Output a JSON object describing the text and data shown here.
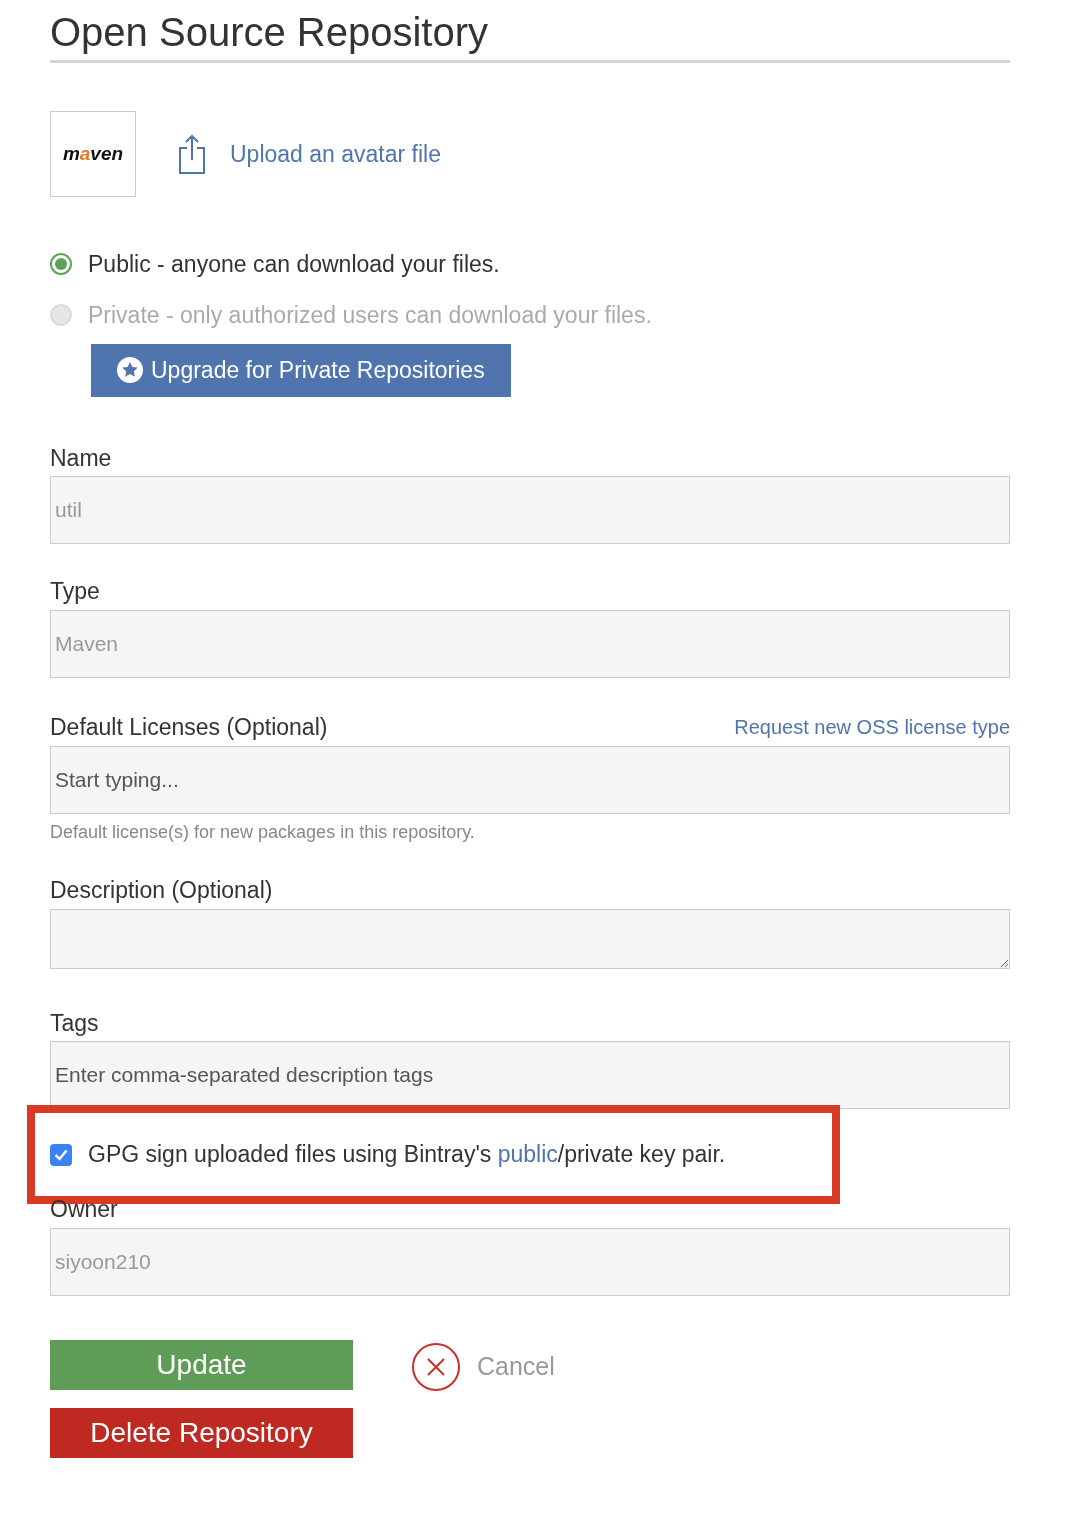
{
  "title": "Open Source Repository",
  "avatar": {
    "logo_text": "maven",
    "upload_link": "Upload an avatar file"
  },
  "visibility": [
    {
      "label": "Public - anyone can download your files.",
      "selected": true,
      "disabled": false
    },
    {
      "label": "Private - only authorized users can download your files.",
      "selected": false,
      "disabled": true
    }
  ],
  "upgrade_button": "Upgrade for Private Repositories",
  "fields": [
    {
      "kind": "input",
      "label": "Name",
      "value": "util",
      "disabled": true
    },
    {
      "kind": "input",
      "label": "Type",
      "value": "Maven",
      "disabled": true
    },
    {
      "kind": "input",
      "label": "Default Licenses (Optional)",
      "link": "Request new OSS license type",
      "placeholder": "Start typing...",
      "help": "Default license(s) for new packages in this repository."
    },
    {
      "kind": "textarea",
      "label": "Description (Optional)"
    },
    {
      "kind": "input",
      "label": "Tags",
      "placeholder": "Enter comma-separated description tags"
    },
    {
      "kind": "checkbox",
      "before": "GPG sign uploaded files using Bintray's ",
      "link": "public",
      "after": "/private key pair.",
      "checked": true,
      "highlighted": true
    },
    {
      "kind": "input",
      "label": "Owner",
      "value": "siyoon210",
      "disabled": true
    }
  ],
  "buttons": {
    "update": "Update",
    "delete": "Delete Repository",
    "cancel": "Cancel"
  }
}
